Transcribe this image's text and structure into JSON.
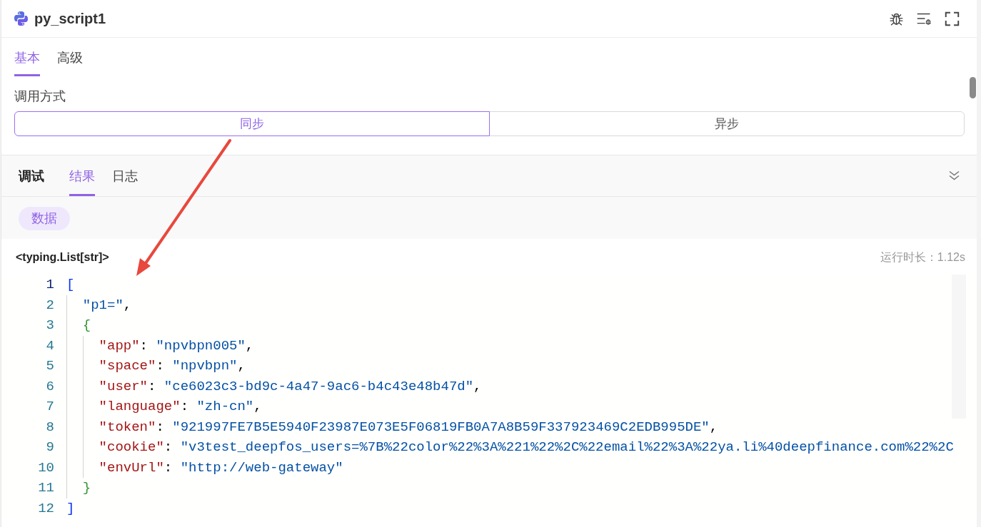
{
  "header": {
    "title": "py_script1"
  },
  "config_tabs": [
    {
      "label": "基本",
      "selected": true
    },
    {
      "label": "高级",
      "selected": false
    }
  ],
  "invoke_mode": {
    "label": "调用方式",
    "options": [
      {
        "label": "同步",
        "selected": true
      },
      {
        "label": "异步",
        "selected": false
      }
    ]
  },
  "debug_panel": {
    "title": "调试",
    "tabs": [
      {
        "label": "结果",
        "selected": true
      },
      {
        "label": "日志",
        "selected": false
      }
    ],
    "filters": [
      {
        "label": "数据",
        "selected": true
      }
    ],
    "result_type": "<typing.List[str]>",
    "duration": "运行时长：1.12s",
    "code_lines": [
      {
        "number": "1",
        "current": true,
        "tokens": [
          {
            "kind": "bracket",
            "text": "["
          }
        ],
        "children": [
          {
            "number": "2",
            "current": false,
            "tokens": [
              {
                "kind": "string",
                "text": "\"p1=\""
              },
              {
                "kind": "punct",
                "text": ","
              }
            ]
          },
          {
            "number": "3",
            "current": false,
            "tokens": [
              {
                "kind": "brace",
                "text": "{"
              }
            ],
            "children": [
              {
                "number": "4",
                "current": false,
                "tokens": [
                  {
                    "kind": "key",
                    "text": "\"app\""
                  },
                  {
                    "kind": "punct",
                    "text": ": "
                  },
                  {
                    "kind": "string",
                    "text": "\"npvbpn005\""
                  },
                  {
                    "kind": "punct",
                    "text": ","
                  }
                ]
              },
              {
                "number": "5",
                "current": false,
                "tokens": [
                  {
                    "kind": "key",
                    "text": "\"space\""
                  },
                  {
                    "kind": "punct",
                    "text": ": "
                  },
                  {
                    "kind": "string",
                    "text": "\"npvbpn\""
                  },
                  {
                    "kind": "punct",
                    "text": ","
                  }
                ]
              },
              {
                "number": "6",
                "current": false,
                "tokens": [
                  {
                    "kind": "key",
                    "text": "\"user\""
                  },
                  {
                    "kind": "punct",
                    "text": ": "
                  },
                  {
                    "kind": "string",
                    "text": "\"ce6023c3-bd9c-4a47-9ac6-b4c43e48b47d\""
                  },
                  {
                    "kind": "punct",
                    "text": ","
                  }
                ]
              },
              {
                "number": "7",
                "current": false,
                "tokens": [
                  {
                    "kind": "key",
                    "text": "\"language\""
                  },
                  {
                    "kind": "punct",
                    "text": ": "
                  },
                  {
                    "kind": "string",
                    "text": "\"zh-cn\""
                  },
                  {
                    "kind": "punct",
                    "text": ","
                  }
                ]
              },
              {
                "number": "8",
                "current": false,
                "tokens": [
                  {
                    "kind": "key",
                    "text": "\"token\""
                  },
                  {
                    "kind": "punct",
                    "text": ": "
                  },
                  {
                    "kind": "string",
                    "text": "\"921997FE7B5E5940F23987E073E5F06819FB0A7A8B59F337923469C2EDB995DE\""
                  },
                  {
                    "kind": "punct",
                    "text": ","
                  }
                ]
              },
              {
                "number": "9",
                "current": false,
                "tokens": [
                  {
                    "kind": "key",
                    "text": "\"cookie\""
                  },
                  {
                    "kind": "punct",
                    "text": ": "
                  },
                  {
                    "kind": "string",
                    "text": "\"v3test_deepfos_users=%7B%22color%22%3A%221%22%2C%22email%22%3A%22ya.li%40deepfinance.com%22%2C"
                  }
                ]
              },
              {
                "number": "10",
                "current": false,
                "tokens": [
                  {
                    "kind": "key",
                    "text": "\"envUrl\""
                  },
                  {
                    "kind": "punct",
                    "text": ": "
                  },
                  {
                    "kind": "string",
                    "text": "\"http://web-gateway\""
                  }
                ]
              }
            ]
          },
          {
            "number": "11",
            "current": false,
            "tokens": [
              {
                "kind": "brace",
                "text": "}"
              }
            ]
          }
        ]
      },
      {
        "number": "12",
        "current": false,
        "tokens": [
          {
            "kind": "bracket",
            "text": "]"
          }
        ]
      }
    ]
  }
}
